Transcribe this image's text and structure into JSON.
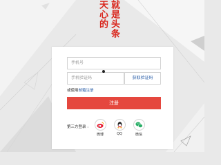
{
  "slogan": {
    "left": "天心的",
    "right": "就是头条"
  },
  "form": {
    "phone_placeholder": "手机号",
    "code_placeholder": "手机验证码",
    "get_code_label": "获取验证码",
    "email_prefix": "或使用",
    "email_link": "邮箱注册",
    "register_label": "注册",
    "third_party_label": "第三方登录 :"
  },
  "social": [
    {
      "label": "微博",
      "icon": "weibo-icon",
      "color": "#e6162d"
    },
    {
      "label": "QQ",
      "icon": "qq-icon",
      "color": "#222222"
    },
    {
      "label": "微信",
      "icon": "wechat-icon",
      "color": "#2aae67"
    }
  ],
  "colors": {
    "accent": "#e5473e",
    "link": "#2a5ea8",
    "slogan": "#d9261c"
  }
}
